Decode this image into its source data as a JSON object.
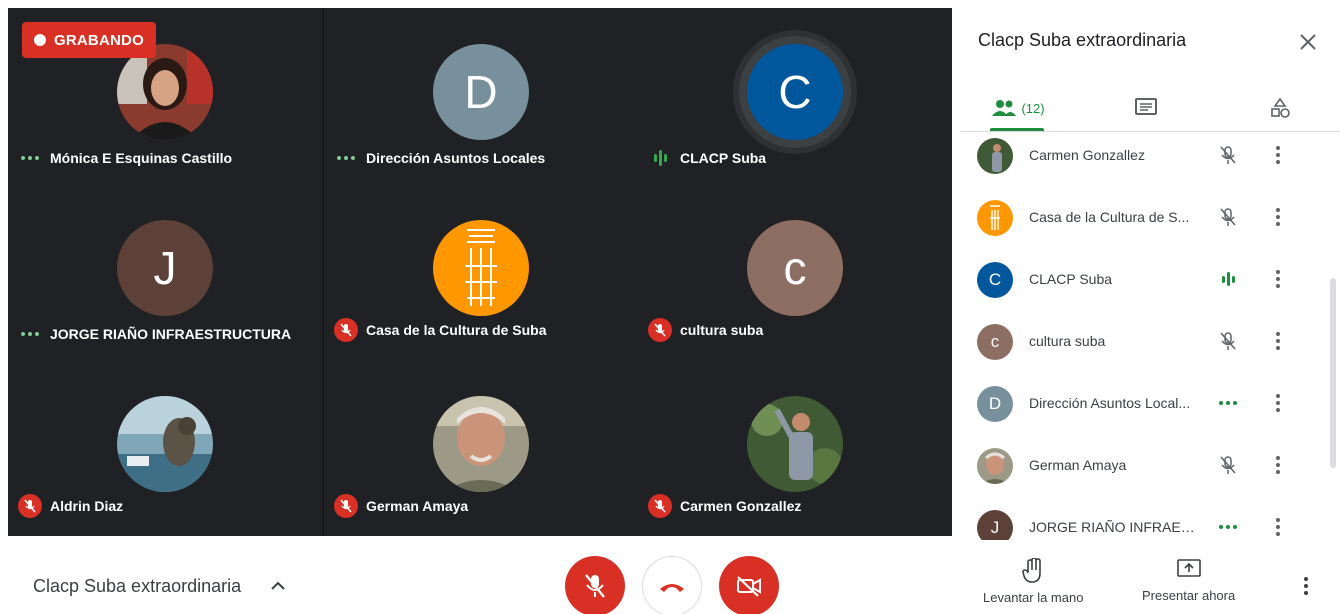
{
  "recording": {
    "label": "GRABANDO",
    "color": "#d93025"
  },
  "tiles": [
    {
      "name": "Mónica E Esquinas Castillo",
      "status": "connecting",
      "avatar_type": "photo",
      "photo": "woman-portrait"
    },
    {
      "name": "Dirección Asuntos Locales",
      "status": "connecting",
      "avatar_type": "letter",
      "letter": "D",
      "avatar_color": "#78909c"
    },
    {
      "name": "CLACP Suba",
      "status": "speaking",
      "avatar_type": "letter",
      "letter": "C",
      "avatar_color": "#01579b"
    },
    {
      "name": "JORGE RIAÑO INFRAESTRUCTURA",
      "status": "connecting",
      "avatar_type": "letter",
      "letter": "J",
      "avatar_color": "#5d4037"
    },
    {
      "name": "Casa de la Cultura de Suba",
      "status": "muted",
      "avatar_type": "logo",
      "avatar_color": "#ff9800"
    },
    {
      "name": "cultura suba",
      "status": "muted",
      "avatar_type": "letter",
      "letter": "c",
      "avatar_color": "#8d6e63"
    },
    {
      "name": "Aldrin Diaz",
      "status": "muted",
      "avatar_type": "photo",
      "photo": "fantasy-landscape"
    },
    {
      "name": "German Amaya",
      "status": "muted",
      "avatar_type": "photo",
      "photo": "older-man-portrait"
    },
    {
      "name": "Carmen Gonzallez",
      "status": "muted",
      "avatar_type": "photo",
      "photo": "woman-in-garden"
    }
  ],
  "panel": {
    "title": "Clacp Suba extraordinaria",
    "tabs": {
      "people_count": "(12)",
      "people_icon": "people-icon",
      "chat_icon": "chat-icon",
      "activities_icon": "activities-icon"
    },
    "participants": [
      {
        "name": "Carmen Gonzallez",
        "status": "muted",
        "avatar_type": "photo",
        "photo": "woman-in-garden"
      },
      {
        "name": "Casa de la Cultura de S...",
        "status": "muted",
        "avatar_type": "logo",
        "avatar_color": "#ff9800"
      },
      {
        "name": "CLACP Suba",
        "status": "speaking",
        "avatar_type": "letter",
        "letter": "C",
        "avatar_color": "#01579b"
      },
      {
        "name": "cultura suba",
        "status": "muted",
        "avatar_type": "letter",
        "letter": "c",
        "avatar_color": "#8d6e63"
      },
      {
        "name": "Dirección Asuntos Local...",
        "status": "connecting",
        "avatar_type": "letter",
        "letter": "D",
        "avatar_color": "#78909c"
      },
      {
        "name": "German Amaya",
        "status": "muted",
        "avatar_type": "photo",
        "photo": "older-man-portrait"
      },
      {
        "name": "JORGE RIAÑO INFRAES...",
        "status": "connecting",
        "avatar_type": "letter",
        "letter": "J",
        "avatar_color": "#5d4037"
      }
    ]
  },
  "bottombar": {
    "meeting_title": "Clacp Suba extraordinaria",
    "raise_hand_label": "Levantar la mano",
    "present_label": "Presentar ahora"
  },
  "colors": {
    "grid_bg": "#202124",
    "accent_green": "#1e8e3e",
    "danger_red": "#d93025"
  }
}
